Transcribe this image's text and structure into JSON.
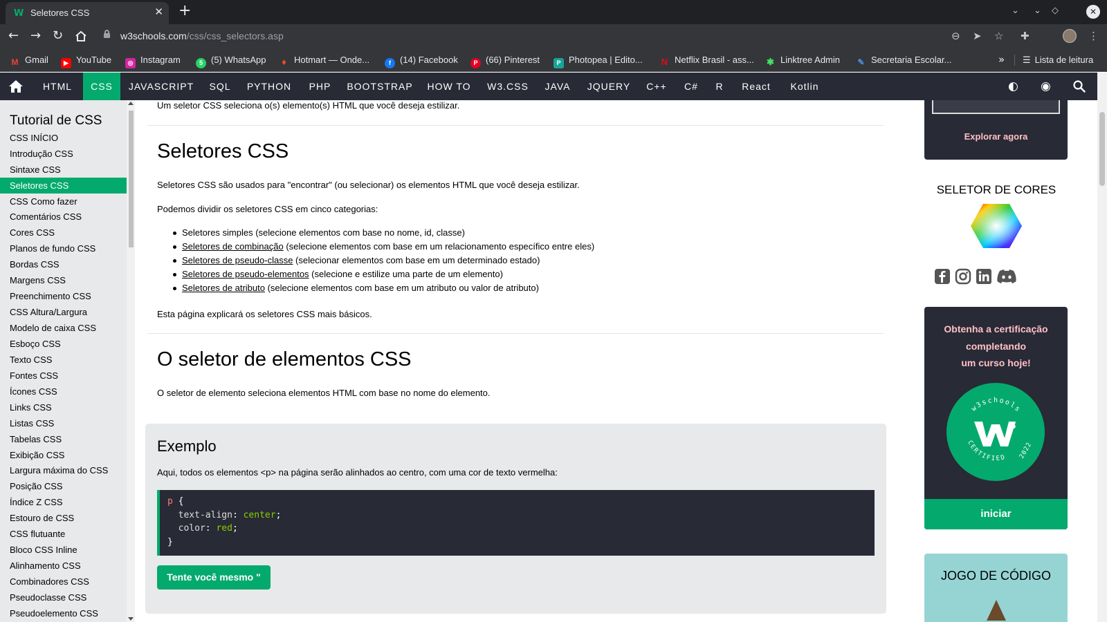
{
  "browser": {
    "tab_title": "Seletores CSS",
    "tab_favicon": "W",
    "url_host": "w3schools.com",
    "url_path": "/css/css_selectors.asp",
    "bookmarks": [
      {
        "label": "Gmail",
        "icon": "gmail-icon",
        "color": "#ea4335",
        "glyph": "M"
      },
      {
        "label": "YouTube",
        "icon": "youtube-icon",
        "color": "#ff0000",
        "glyph": "▶"
      },
      {
        "label": "Instagram",
        "icon": "instagram-icon",
        "color": "#d6249f",
        "glyph": "◎"
      },
      {
        "label": "(5) WhatsApp",
        "icon": "whatsapp-icon",
        "color": "#25d366",
        "glyph": "5"
      },
      {
        "label": "Hotmart — Onde...",
        "icon": "hotmart-icon",
        "color": "#f04e23",
        "glyph": "♦"
      },
      {
        "label": "(14) Facebook",
        "icon": "facebook-icon",
        "color": "#1877f2",
        "glyph": "f"
      },
      {
        "label": "(66) Pinterest",
        "icon": "pinterest-icon",
        "color": "#e60023",
        "glyph": "P"
      },
      {
        "label": "Photopea | Edito...",
        "icon": "photopea-icon",
        "color": "#18a497",
        "glyph": "P"
      },
      {
        "label": "Netflix Brasil - ass...",
        "icon": "netflix-icon",
        "color": "#e50914",
        "glyph": "N"
      },
      {
        "label": "Linktree Admin",
        "icon": "linktree-icon",
        "color": "#43e660",
        "glyph": "✱"
      },
      {
        "label": "Secretaria Escolar...",
        "icon": "secretaria-icon",
        "color": "#4a90d9",
        "glyph": "✎"
      }
    ],
    "reading_list": "Lista de leitura"
  },
  "topnav": {
    "items": [
      "HTML",
      "CSS",
      "JAVASCRIPT",
      "SQL",
      "PYTHON",
      "PHP",
      "BOOTSTRAP",
      "HOW TO",
      "W3.CSS",
      "JAVA",
      "JQUERY",
      "C++",
      "C#",
      "R",
      "React",
      "Kotlin"
    ],
    "active": "CSS"
  },
  "sidebar": {
    "title": "Tutorial de CSS",
    "items": [
      "CSS INÍCIO",
      "Introdução CSS",
      "Sintaxe CSS",
      "Seletores CSS",
      "CSS Como fazer",
      "Comentários CSS",
      "Cores CSS",
      "Planos de fundo CSS",
      "Bordas CSS",
      "Margens CSS",
      "Preenchimento CSS",
      "CSS Altura/Largura",
      "Modelo de caixa CSS",
      "Esboço CSS",
      "Texto CSS",
      "Fontes CSS",
      "Ícones CSS",
      "Links CSS",
      "Listas CSS",
      "Tabelas CSS",
      "Exibição CSS",
      "Largura máxima do CSS",
      "Posição CSS",
      "Índice Z CSS",
      "Estouro de CSS",
      "CSS flutuante",
      "Bloco CSS Inline",
      "Alinhamento CSS",
      "Combinadores CSS",
      "Pseudoclasse CSS",
      "Pseudoelemento CSS"
    ],
    "active_index": 3
  },
  "main": {
    "intro": "Um seletor CSS seleciona o(s) elemento(s) HTML que você deseja estilizar.",
    "h1_selectors": "Seletores CSS",
    "p1": "Seletores CSS são usados para \"encontrar\" (ou selecionar) os elementos HTML que você deseja estilizar.",
    "p2": "Podemos dividir os seletores CSS em cinco categorias:",
    "list": [
      {
        "link": "",
        "text": "Seletores simples (selecione elementos com base no nome, id, classe)"
      },
      {
        "link": "Seletores de combinação",
        "text": " (selecione elementos com base em um relacionamento específico entre eles)"
      },
      {
        "link": "Seletores de pseudo-classe",
        "text": " (selecionar elementos com base em um determinado estado)"
      },
      {
        "link": "Seletores de pseudo-elementos",
        "text": " (selecione e estilize uma parte de um elemento)"
      },
      {
        "link": "Seletores de atributo",
        "text": " (selecione elementos com base em um atributo ou valor de atributo)"
      }
    ],
    "p3": "Esta página explicará os seletores CSS mais básicos.",
    "h1_element": "O seletor de elementos CSS",
    "p4": "O seletor de elemento seleciona elementos HTML com base no nome do elemento.",
    "example": {
      "title": "Exemplo",
      "desc": "Aqui, todos os elementos <p> na página serão alinhados ao centro, com uma cor de texto vermelha:",
      "code": {
        "selector": "p",
        "open": " {",
        "props": [
          {
            "name": "text-align",
            "value": "center"
          },
          {
            "name": "color",
            "value": "red"
          }
        ],
        "close": "}"
      },
      "button": "Tente você mesmo \""
    }
  },
  "right": {
    "promo_link": "Explorar agora",
    "picker_title": "SELETOR DE CORES",
    "social_icons": [
      "facebook-icon",
      "instagram-icon",
      "linkedin-icon",
      "discord-icon"
    ],
    "cert_text": [
      "Obtenha a certificação",
      "completando",
      "um curso hoje!"
    ],
    "cert_badge_top": "w3schools",
    "cert_badge_bottom": "CERTIFIED",
    "cert_badge_year": "2022",
    "cert_button": "iniciar",
    "game_title": "JOGO DE CÓDIGO"
  },
  "colors": {
    "accent": "#04aa6d",
    "dark": "#282a35",
    "pink": "#ffc0c7"
  }
}
